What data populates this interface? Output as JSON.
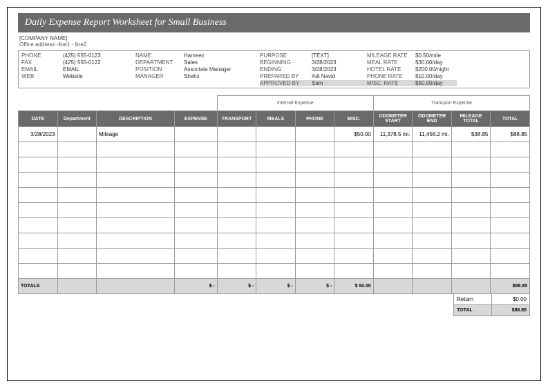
{
  "title": "Daily Expense Report Worksheet for Small Business",
  "company_name": "[COMPANY NAME]",
  "address_line": "Office address -line1 - line2",
  "info": {
    "phone_lbl": "PHONE",
    "phone_val": "(425) 555-0123",
    "fax_lbl": "FAX",
    "fax_val": "(425) 555-0122",
    "email_lbl": "EMAIL",
    "email_val": "EMAIL",
    "web_lbl": "WEB",
    "web_val": "Website",
    "name_lbl": "NAME",
    "name_val": "Hameez",
    "dept_lbl": "DEPARTMENT",
    "dept_val": "Sales",
    "pos_lbl": "POSITION",
    "pos_val": "Associate Manager",
    "mgr_lbl": "MANAGER",
    "mgr_val": "Shahz",
    "purpose_lbl": "PURPOSE",
    "purpose_val": "[TEXT]",
    "begin_lbl": "BEGINNING",
    "begin_val": "3/28/2023",
    "end_lbl": "ENDING",
    "end_val": "3/28/2023",
    "prep_lbl": "PREPARED BY",
    "prep_val": "Adi Navid",
    "appr_lbl": "APPROVED BY",
    "appr_val": "Sam",
    "mileage_lbl": "MILEAGE RATE",
    "mileage_val": "$0.50/mile",
    "meal_lbl": "MEAL RATE",
    "meal_val": "$30.00/day",
    "hotel_lbl": "HOTEL RATE",
    "hotel_val": "$200.00/night",
    "phrate_lbl": "PHONE RATE",
    "phrate_val": "$10.00/day",
    "misc_lbl": "MISC. RATE",
    "misc_val": "$50.00/day"
  },
  "categories": {
    "internal": "Internal Expense",
    "transport": "Transport Expense"
  },
  "headers": {
    "date": "DATE",
    "dept": "Department",
    "desc": "DESCRIPTION",
    "exp": "EXPENSE",
    "transport": "TRANSPORT",
    "meals": "MEALS",
    "phone": "PHONE",
    "misc": "MISC.",
    "odo_start": "ODOMETER START",
    "odo_end": "ODOMETER END",
    "mileage_total": "MILEAGE TOTAL",
    "total": "TOTAL"
  },
  "rows": [
    {
      "date": "3/28/2023",
      "dept": "",
      "desc": "Mileage",
      "exp": "",
      "transport": "",
      "meals": "",
      "phone": "",
      "misc": "$50.00",
      "odo_start": "11,378.5 mi.",
      "odo_end": "11,456.2 mi.",
      "mileage_total": "$38.85",
      "total": "$88.85"
    }
  ],
  "totals": {
    "label": "TOTALS",
    "exp": "$            -",
    "transport": "$            -",
    "meals": "$            -",
    "phone": "$            -",
    "misc": "$         50.00",
    "grand": "$88.85"
  },
  "summary": {
    "return_lbl": "Return",
    "return_val": "$0.00",
    "total_lbl": "TOTAL",
    "total_val": "$88.85"
  }
}
